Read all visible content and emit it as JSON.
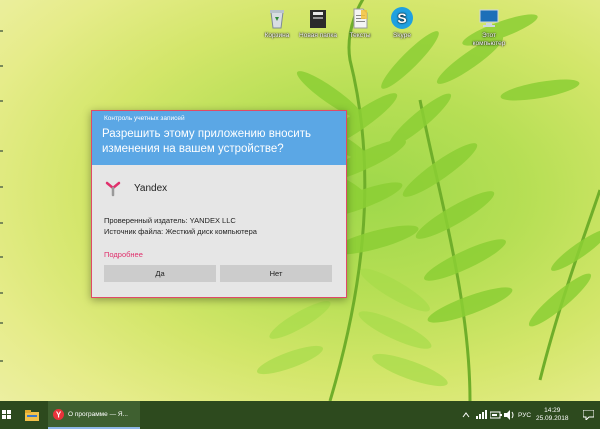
{
  "desktop": {
    "icons": [
      {
        "label": "Корзина",
        "icon": "recycle-bin-icon"
      },
      {
        "label": "Новая папка",
        "icon": "folder-icon"
      },
      {
        "label": "Тексты",
        "icon": "text-file-icon"
      },
      {
        "label": "Skype",
        "icon": "skype-icon"
      },
      {
        "label": "Этот компьютер",
        "icon": "computer-icon"
      }
    ]
  },
  "uac": {
    "caption": "Контроль учетных записей",
    "question": "Разрешить этому приложению вносить изменения на вашем устройстве?",
    "app_name": "Yandex",
    "publisher": "Проверенный издатель: YANDEX LLC",
    "source": "Источник файла: Жесткий диск компьютера",
    "more_link": "Подробнее",
    "yes_label": "Да",
    "no_label": "Нет",
    "header_color": "#5ba7e5",
    "link_color": "#e0306c"
  },
  "taskbar": {
    "active_window_title": "О программе — Я...",
    "language": "РУС",
    "time": "14:29",
    "date": "25.09.2018"
  }
}
